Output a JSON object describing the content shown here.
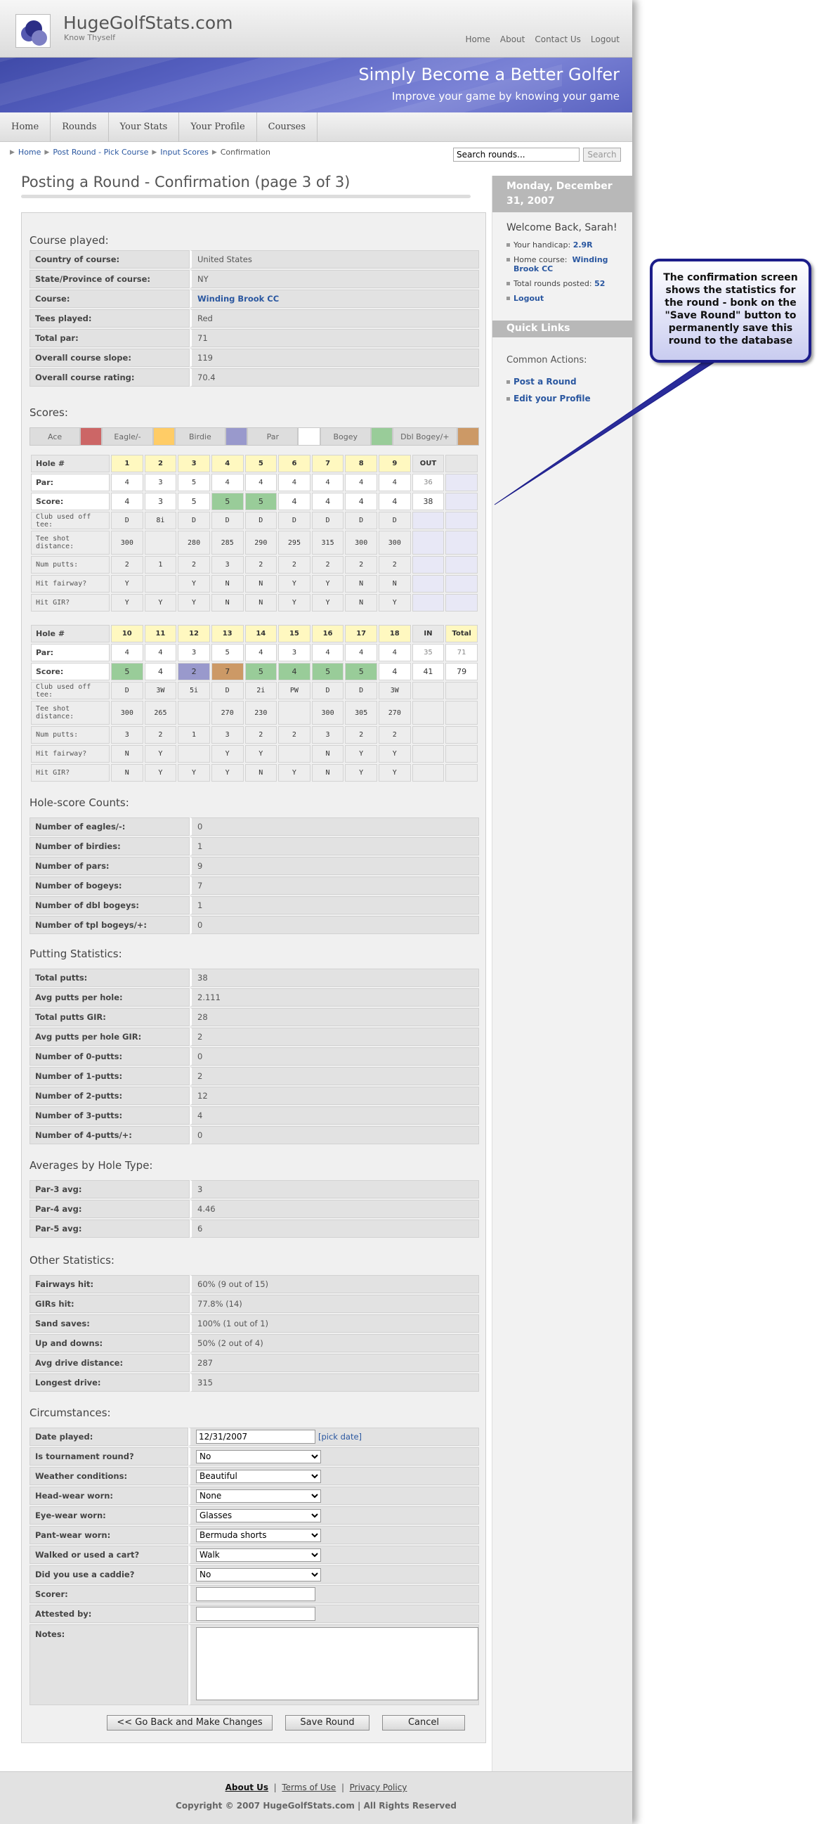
{
  "header": {
    "site_name": "HugeGolfStats.com",
    "tagline": "Know Thyself",
    "nav": [
      "Home",
      "About",
      "Contact Us",
      "Logout"
    ]
  },
  "banner": {
    "title": "Simply Become a Better Golfer",
    "subtitle": "Improve your game by knowing your game"
  },
  "tabs": [
    "Home",
    "Rounds",
    "Your Stats",
    "Your Profile",
    "Courses"
  ],
  "breadcrumb": [
    "Home",
    "Post Round - Pick Course",
    "Input Scores",
    "Confirmation"
  ],
  "search": {
    "value": "Search rounds...",
    "button": "Search"
  },
  "page_title": "Posting a Round - Confirmation (page 3 of 3)",
  "course": {
    "heading": "Course played:",
    "rows": [
      [
        "Country of course:",
        "United States"
      ],
      [
        "State/Province of course:",
        "NY"
      ],
      [
        "Course:",
        "Winding Brook CC"
      ],
      [
        "Tees played:",
        "Red"
      ],
      [
        "Total par:",
        "71"
      ],
      [
        "Overall course slope:",
        "119"
      ],
      [
        "Overall course rating:",
        "70.4"
      ]
    ]
  },
  "scores": {
    "heading": "Scores:",
    "legend": [
      {
        "label": "Ace",
        "color": "#cc6666"
      },
      {
        "label": "Eagle/-",
        "color": "#ffcc66"
      },
      {
        "label": "Birdie",
        "color": "#9999cc"
      },
      {
        "label": "Par",
        "color": "#ffffff"
      },
      {
        "label": "Bogey",
        "color": "#99cc99"
      },
      {
        "label": "Dbl Bogey/+",
        "color": "#cc9966"
      }
    ],
    "front": {
      "hole_label": "Hole #",
      "holes": [
        "1",
        "2",
        "3",
        "4",
        "5",
        "6",
        "7",
        "8",
        "9"
      ],
      "sum_label": "OUT",
      "par": [
        "4",
        "3",
        "5",
        "4",
        "4",
        "4",
        "4",
        "4",
        "4"
      ],
      "par_sum": "36",
      "score": [
        "4",
        "3",
        "5",
        "5",
        "5",
        "4",
        "4",
        "4",
        "4"
      ],
      "score_sum": "38",
      "club": [
        "D",
        "8i",
        "D",
        "D",
        "D",
        "D",
        "D",
        "D",
        "D"
      ],
      "tee": [
        "300",
        "",
        "280",
        "285",
        "290",
        "295",
        "315",
        "300",
        "300"
      ],
      "putts": [
        "2",
        "1",
        "2",
        "3",
        "2",
        "2",
        "2",
        "2",
        "2"
      ],
      "fairway": [
        "Y",
        "",
        "Y",
        "N",
        "N",
        "Y",
        "Y",
        "N",
        "N"
      ],
      "gir": [
        "Y",
        "Y",
        "Y",
        "N",
        "N",
        "Y",
        "Y",
        "N",
        "Y"
      ]
    },
    "back": {
      "hole_label": "Hole #",
      "holes": [
        "10",
        "11",
        "12",
        "13",
        "14",
        "15",
        "16",
        "17",
        "18"
      ],
      "sum_label": "IN",
      "total_label": "Total",
      "par": [
        "4",
        "4",
        "3",
        "5",
        "4",
        "3",
        "4",
        "4",
        "4"
      ],
      "par_sum": "35",
      "par_total": "71",
      "score": [
        "5",
        "4",
        "2",
        "7",
        "5",
        "4",
        "5",
        "5",
        "4"
      ],
      "score_sum": "41",
      "score_total": "79",
      "club": [
        "D",
        "3W",
        "5i",
        "D",
        "2i",
        "PW",
        "D",
        "D",
        "3W"
      ],
      "tee": [
        "300",
        "265",
        "",
        "270",
        "230",
        "",
        "300",
        "305",
        "270"
      ],
      "putts": [
        "3",
        "2",
        "1",
        "3",
        "2",
        "2",
        "3",
        "2",
        "2"
      ],
      "fairway": [
        "N",
        "Y",
        "",
        "Y",
        "Y",
        "",
        "N",
        "Y",
        "Y"
      ],
      "gir": [
        "N",
        "Y",
        "Y",
        "Y",
        "N",
        "Y",
        "N",
        "Y",
        "Y"
      ]
    },
    "row_labels": {
      "par": "Par:",
      "score": "Score:",
      "club": "Club used off tee:",
      "tee": "Tee shot distance:",
      "putts": "Num putts:",
      "fairway": "Hit fairway?",
      "gir": "Hit GIR?"
    }
  },
  "counts": {
    "heading": "Hole-score Counts:",
    "rows": [
      [
        "Number of eagles/-:",
        "0"
      ],
      [
        "Number of birdies:",
        "1"
      ],
      [
        "Number of pars:",
        "9"
      ],
      [
        "Number of bogeys:",
        "7"
      ],
      [
        "Number of dbl bogeys:",
        "1"
      ],
      [
        "Number of tpl bogeys/+:",
        "0"
      ]
    ]
  },
  "putting": {
    "heading": "Putting Statistics:",
    "rows": [
      [
        "Total putts:",
        "38"
      ],
      [
        "Avg putts per hole:",
        "2.111"
      ],
      [
        "Total putts GIR:",
        "28"
      ],
      [
        "Avg putts per hole GIR:",
        "2"
      ],
      [
        "Number of 0-putts:",
        "0"
      ],
      [
        "Number of 1-putts:",
        "2"
      ],
      [
        "Number of 2-putts:",
        "12"
      ],
      [
        "Number of 3-putts:",
        "4"
      ],
      [
        "Number of 4-putts/+:",
        "0"
      ]
    ]
  },
  "averages": {
    "heading": "Averages by Hole Type:",
    "rows": [
      [
        "Par-3 avg:",
        "3"
      ],
      [
        "Par-4 avg:",
        "4.46"
      ],
      [
        "Par-5 avg:",
        "6"
      ]
    ]
  },
  "other": {
    "heading": "Other Statistics:",
    "rows": [
      [
        "Fairways hit:",
        "60% (9 out of 15)"
      ],
      [
        "GIRs hit:",
        "77.8% (14)"
      ],
      [
        "Sand saves:",
        "100% (1 out of 1)"
      ],
      [
        "Up and downs:",
        "50% (2 out of 4)"
      ],
      [
        "Avg drive distance:",
        "287"
      ],
      [
        "Longest drive:",
        "315"
      ]
    ]
  },
  "circumstances": {
    "heading": "Circumstances:",
    "date_label": "Date played:",
    "date_value": "12/31/2007",
    "pick_date": "[pick date]",
    "selects": [
      [
        "Is tournament round?",
        "No"
      ],
      [
        "Weather conditions:",
        "Beautiful"
      ],
      [
        "Head-wear worn:",
        "None"
      ],
      [
        "Eye-wear worn:",
        "Glasses"
      ],
      [
        "Pant-wear worn:",
        "Bermuda shorts"
      ],
      [
        "Walked or used a cart?",
        "Walk"
      ],
      [
        "Did you use a caddie?",
        "No"
      ]
    ],
    "scorer_label": "Scorer:",
    "attested_label": "Attested by:",
    "notes_label": "Notes:"
  },
  "buttons": {
    "back": "<< Go Back and Make Changes",
    "save": "Save Round",
    "cancel": "Cancel"
  },
  "sidebar": {
    "date": "Monday, December 31, 2007",
    "welcome": "Welcome Back, Sarah!",
    "handicap_label": "Your handicap:",
    "handicap": "2.9R",
    "home_label": "Home course:",
    "home_course": "Winding Brook CC",
    "rounds_label": "Total rounds posted:",
    "rounds": "52",
    "logout": "Logout",
    "quick_links": "Quick Links",
    "common_actions": "Common Actions:",
    "post_round": "Post a Round",
    "edit_profile": "Edit your Profile"
  },
  "footer": {
    "links": [
      "About Us",
      "Terms of Use",
      "Privacy Policy"
    ],
    "copyright": "Copyright © 2007 HugeGolfStats.com | All Rights Reserved"
  },
  "callout": "The confirmation screen shows the statistics for the round - bonk on the \"Save Round\" button to permanently save this round to the database"
}
